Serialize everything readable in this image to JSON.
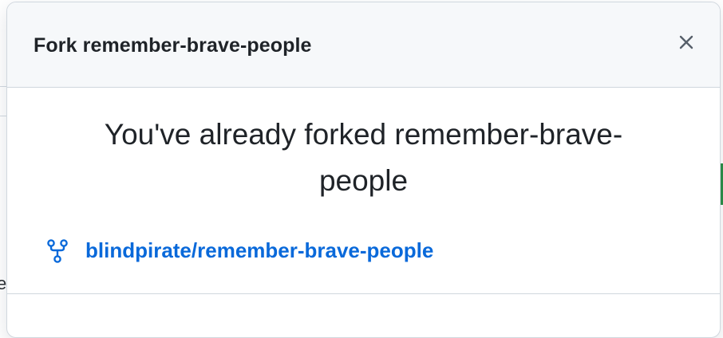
{
  "dialog": {
    "title": "Fork remember-brave-people",
    "close_icon": "close-icon",
    "message": "You've already forked remember-brave-people",
    "fork_icon": "repo-forked-icon",
    "fork_link": "blindpirate/remember-brave-people"
  },
  "background": {
    "fragment_text": "e"
  },
  "colors": {
    "link": "#0969da",
    "header_bg": "#f6f8fa",
    "border": "#d0d7de",
    "text": "#1f2328"
  }
}
